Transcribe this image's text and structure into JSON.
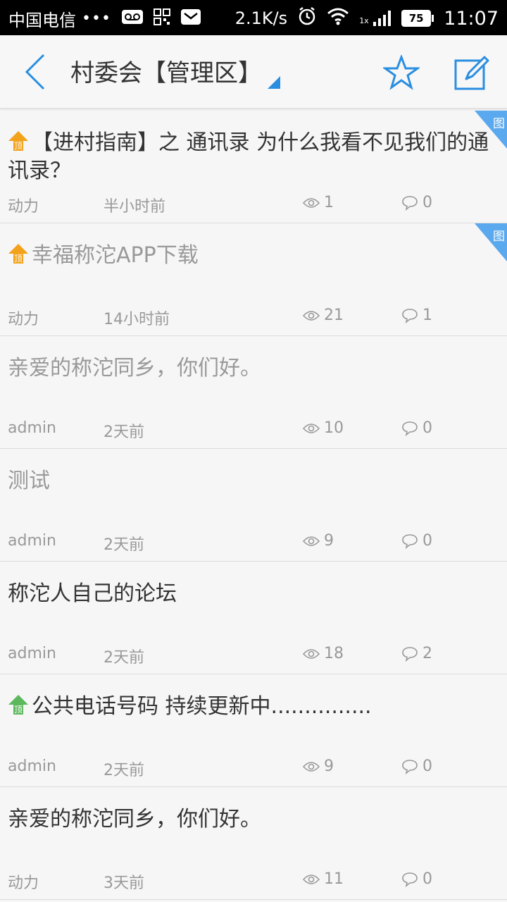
{
  "status_bar": {
    "carrier": "中国电信",
    "dots": "•••",
    "net_speed": "2.1K/s",
    "network_label": "1x",
    "battery": "75",
    "time": "11:07"
  },
  "header": {
    "title": "村委会【管理区】"
  },
  "posts": [
    {
      "title": "【进村指南】之 通讯录 为什么我看不见我们的通讯录？",
      "author": "动力",
      "time": "半小时前",
      "views": "1",
      "comments": "0",
      "pin": "orange",
      "pin_label": "顶",
      "image_tag": "图"
    },
    {
      "title": "幸福称沱APP下载",
      "author": "动力",
      "time": "14小时前",
      "views": "21",
      "comments": "1",
      "pin": "orange",
      "pin_label": "顶",
      "image_tag": "图",
      "read": true
    },
    {
      "title": "亲爱的称沱同乡，你们好。",
      "author": "admin",
      "time": "2天前",
      "views": "10",
      "comments": "0",
      "read": true
    },
    {
      "title": "测试",
      "author": "admin",
      "time": "2天前",
      "views": "9",
      "comments": "0",
      "read": true
    },
    {
      "title": "称沱人自己的论坛",
      "author": "admin",
      "time": "2天前",
      "views": "18",
      "comments": "2"
    },
    {
      "title": "公共电话号码 持续更新中...............",
      "author": "admin",
      "time": "2天前",
      "views": "9",
      "comments": "0",
      "pin": "green",
      "pin_label": "顶"
    },
    {
      "title": "亲爱的称沱同乡，你们好。",
      "author": "动力",
      "time": "3天前",
      "views": "11",
      "comments": "0"
    }
  ],
  "colors": {
    "accent": "#2a8ee0",
    "pin_orange": "#f2a21b",
    "pin_green": "#5cb85c",
    "corner_tag": "#5aa8ee"
  }
}
